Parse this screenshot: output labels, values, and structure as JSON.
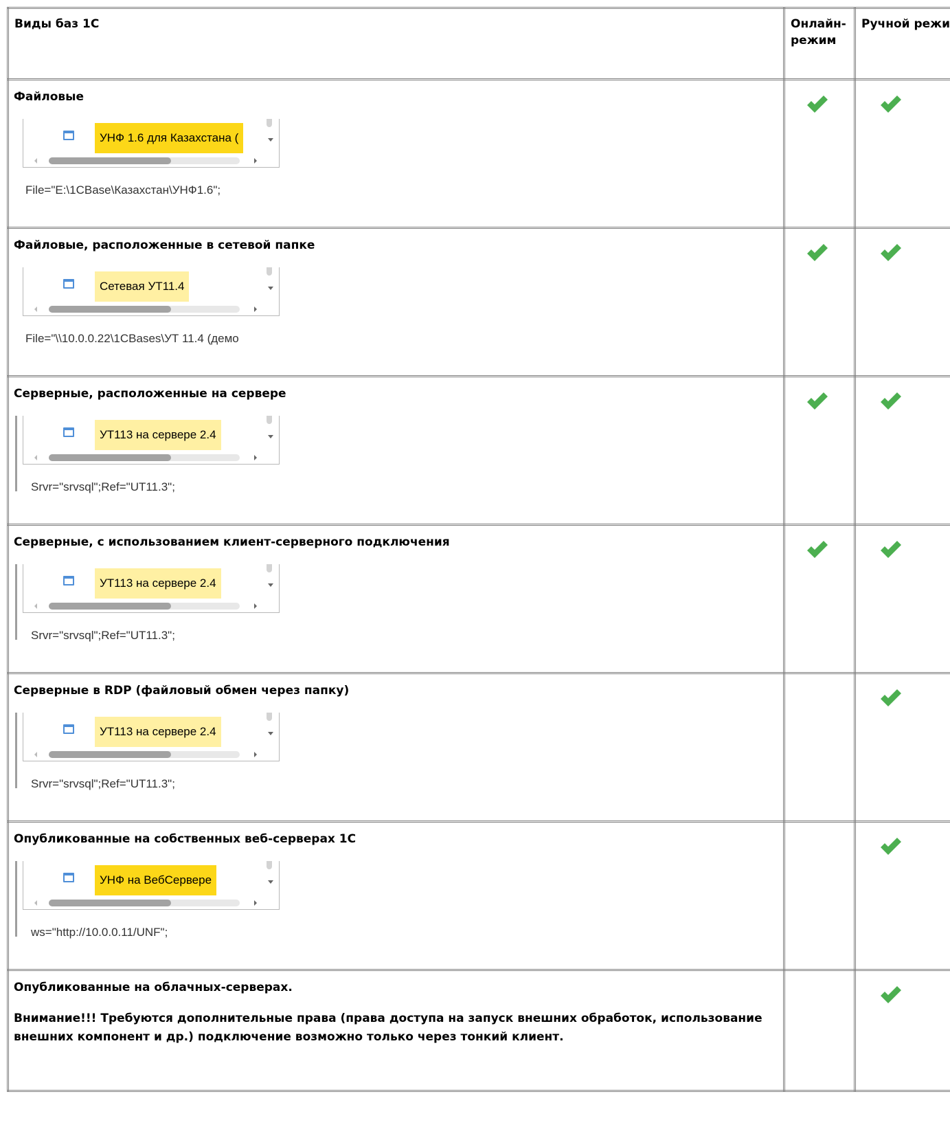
{
  "header": {
    "col_types": "Виды баз 1С",
    "col_online": "Онлайн-режим",
    "col_manual": "Ручной режим"
  },
  "rows": [
    {
      "title": "Файловые",
      "base_name": "УНФ 1.6 для Казахстана (",
      "connection": "File=\"E:\\1CBase\\Казахстан\\УНФ1.6\";",
      "online": true,
      "manual": true
    },
    {
      "title": "Файловые, расположенные в сетевой папке",
      "base_name": "Сетевая УТ11.4",
      "connection": "File=\"\\\\10.0.0.22\\1CBases\\УТ 11.4 (демо",
      "online": true,
      "manual": true
    },
    {
      "title": "Серверные, расположенные на сервере",
      "base_name": "УТ113 на сервере 2.4",
      "connection": "Srvr=\"srvsql\";Ref=\"UT11.3\";",
      "online": true,
      "manual": true
    },
    {
      "title": "Серверные, с использованием клиент-серверного подключения",
      "base_name": "УТ113 на сервере 2.4",
      "connection": "Srvr=\"srvsql\";Ref=\"UT11.3\";",
      "online": true,
      "manual": true
    },
    {
      "title": "Серверные в RDP (файловый обмен через папку)",
      "base_name": "УТ113 на сервере 2.4",
      "connection": "Srvr=\"srvsql\";Ref=\"UT11.3\";",
      "online": false,
      "manual": true
    },
    {
      "title": "Опубликованные на собственных веб-серверах 1С",
      "base_name": "УНФ на ВебСервере",
      "connection": "ws=\"http://10.0.0.11/UNF\";",
      "online": false,
      "manual": true
    },
    {
      "title": "Опубликованные на облачных-серверах.",
      "note": "Внимание!!! Требуются дополнительные права (права доступа на запуск внешних обработок, использование внешних компонент и др.) подключение возможно только через тонкий клиент.",
      "online": false,
      "manual": true
    }
  ],
  "colors": {
    "check": "#4caf50",
    "highlight_strong": "#fcd718",
    "highlight_soft": "#fff0a3",
    "db_icon": "#4f8fd8"
  },
  "icons": {
    "check": "check-icon",
    "database": "database-icon"
  }
}
